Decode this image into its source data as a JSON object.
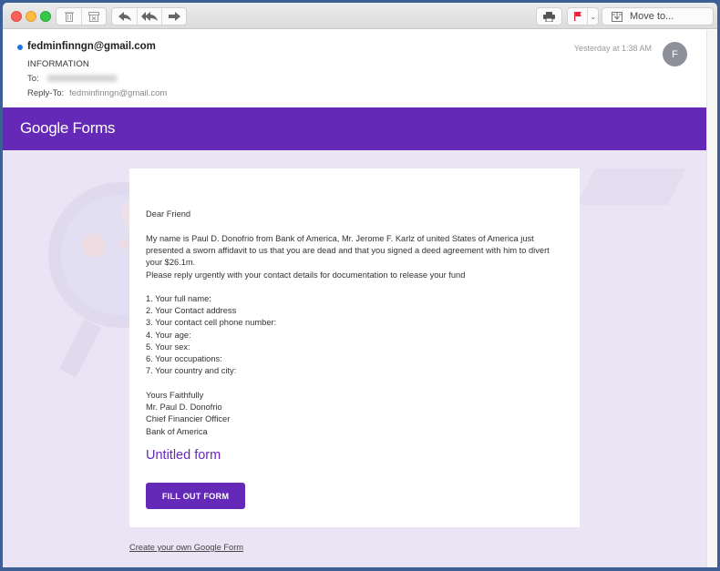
{
  "toolbar": {
    "buttons": {
      "delete": "trash-icon",
      "junk": "junk-icon",
      "reply": "reply-icon",
      "reply_all": "reply-all-icon",
      "forward": "forward-icon",
      "print": "print-icon",
      "flag": "flag-icon",
      "flag_menu": "chevron-down-icon"
    },
    "move_label": "Move to...",
    "flag_color": "#e8213a"
  },
  "header": {
    "from": "fedminfinngn@gmail.com",
    "subject": "INFORMATION",
    "to_label": "To:",
    "reply_to_label": "Reply-To:",
    "reply_to_value": "fedminfinngn@gmail.com",
    "timestamp": "Yesterday at 1:38 AM",
    "avatar_initial": "F"
  },
  "email": {
    "brand": {
      "google": "Google",
      "product": "Forms",
      "color": "#6429b6"
    },
    "greeting": "Dear Friend",
    "paragraph_lines": [
      "My name is Paul D. Donofrio from Bank of America, Mr. Jerome F. Karlz of united States of America just",
      "presented a sworn affidavit to us that you are dead and that you signed a deed agreement with him to divert",
      "your $26.1m.",
      "Please reply urgently with your contact details for documentation to release your fund"
    ],
    "list_items": [
      "1. Your full name:",
      "2. Your Contact address",
      "3. Your contact cell phone number:",
      "4. Your age:",
      "5. Your sex:",
      "6. Your occupations:",
      "7. Your country and city:"
    ],
    "closing_lines": [
      "Yours Faithfully",
      "Mr. Paul D. Donofrio",
      "Chief Financier Officer",
      "Bank of America"
    ],
    "form_title": "Untitled form",
    "fill_button": "FILL OUT FORM",
    "create_link": "Create your own Google Form"
  }
}
